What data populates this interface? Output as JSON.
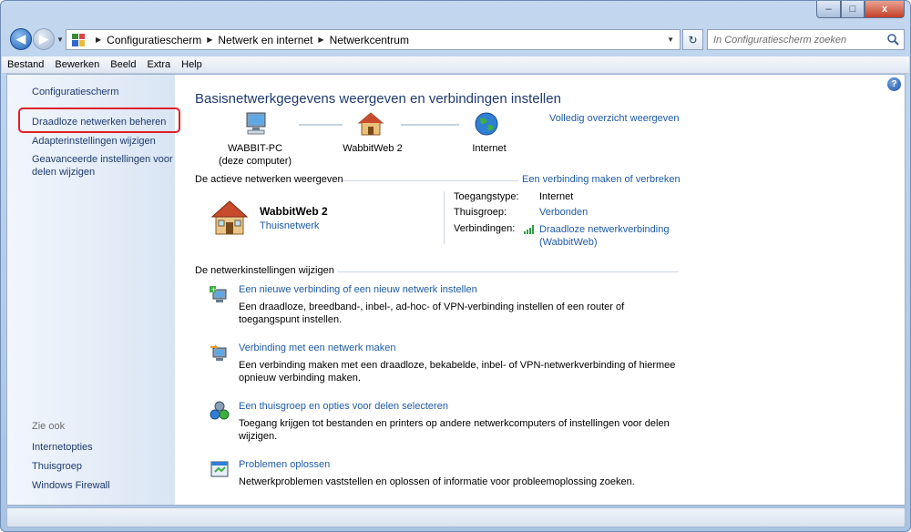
{
  "window": {
    "caption": {
      "minimize": "–",
      "maximize": "□",
      "close": "x"
    }
  },
  "address": {
    "crumbs": [
      "Configuratiescherm",
      "Netwerk en internet",
      "Netwerkcentrum"
    ],
    "search_placeholder": "In Configuratiescherm zoeken"
  },
  "menu": [
    "Bestand",
    "Bewerken",
    "Beeld",
    "Extra",
    "Help"
  ],
  "sidebar": {
    "home": "Configuratiescherm",
    "links": [
      "Draadloze netwerken beheren",
      "Adapterinstellingen wijzigen",
      "Geavanceerde instellingen voor delen wijzigen"
    ],
    "see_also_title": "Zie ook",
    "see_also": [
      "Internetopties",
      "Thuisgroep",
      "Windows Firewall"
    ]
  },
  "main": {
    "title": "Basisnetwerkgegevens weergeven en verbindingen instellen",
    "full_map_link": "Volledig overzicht weergeven",
    "map": {
      "pc_name": "WABBIT-PC",
      "pc_sub": "(deze computer)",
      "network": "WabbitWeb  2",
      "internet": "Internet"
    },
    "active_section": {
      "header": "De actieve netwerken weergeven",
      "connect_link": "Een verbinding maken of verbreken",
      "network_name": "WabbitWeb  2",
      "network_type": "Thuisnetwerk",
      "access_label": "Toegangstype:",
      "access_value": "Internet",
      "homegroup_label": "Thuisgroep:",
      "homegroup_value": "Verbonden",
      "connections_label": "Verbindingen:",
      "connections_value_1": "Draadloze netwerkverbinding",
      "connections_value_2": "(WabbitWeb)"
    },
    "change_section": {
      "header": "De netwerkinstellingen wijzigen",
      "tasks": [
        {
          "title": "Een nieuwe verbinding of een nieuw netwerk instellen",
          "desc": "Een draadloze, breedband-, inbel-, ad-hoc- of VPN-verbinding instellen of een router of toegangspunt instellen."
        },
        {
          "title": "Verbinding met een netwerk maken",
          "desc": "Een verbinding maken met een draadloze, bekabelde, inbel- of VPN-netwerkverbinding of hiermee opnieuw verbinding maken."
        },
        {
          "title": "Een thuisgroep en opties voor delen selecteren",
          "desc": "Toegang krijgen tot bestanden en printers op andere netwerkcomputers of instellingen voor delen wijzigen."
        },
        {
          "title": "Problemen oplossen",
          "desc": "Netwerkproblemen vaststellen en oplossen of informatie voor probleemoplossing zoeken."
        }
      ]
    }
  },
  "help_label": "?"
}
